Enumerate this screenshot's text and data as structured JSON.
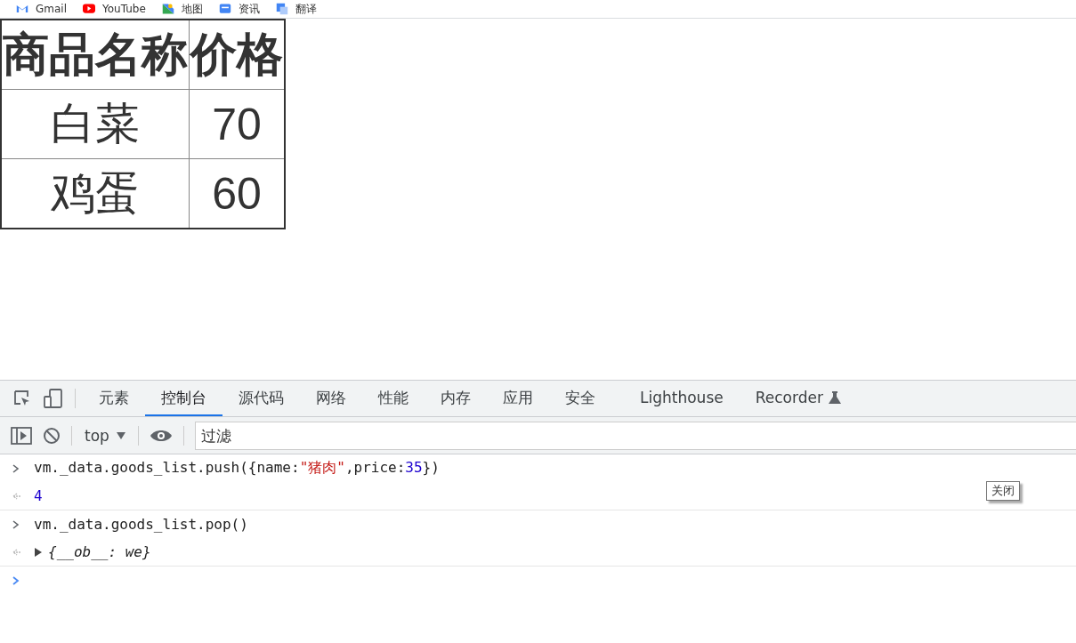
{
  "bookmarks": [
    {
      "label": "Gmail",
      "kind": "gmail"
    },
    {
      "label": "YouTube",
      "kind": "youtube"
    },
    {
      "label": "地图",
      "kind": "maps"
    },
    {
      "label": "资讯",
      "kind": "news"
    },
    {
      "label": "翻译",
      "kind": "translate"
    }
  ],
  "table": {
    "columns": [
      "商品名称",
      "价格"
    ],
    "rows": [
      [
        "白菜",
        "70"
      ],
      [
        "鸡蛋",
        "60"
      ]
    ]
  },
  "devtools": {
    "tabs": [
      {
        "label": "元素",
        "selected": false
      },
      {
        "label": "控制台",
        "selected": true
      },
      {
        "label": "源代码",
        "selected": false
      },
      {
        "label": "网络",
        "selected": false
      },
      {
        "label": "性能",
        "selected": false
      },
      {
        "label": "内存",
        "selected": false
      },
      {
        "label": "应用",
        "selected": false
      },
      {
        "label": "安全",
        "selected": false
      },
      {
        "label": "Lighthouse",
        "selected": false
      },
      {
        "label": "Recorder",
        "selected": false
      }
    ],
    "context": "top",
    "filter": {
      "placeholder": "过滤"
    },
    "console": [
      {
        "kind": "input",
        "tokens": [
          {
            "text": "vm._data.goods_list.push({name:",
            "kind": "plain"
          },
          {
            "text": "\"猪肉\"",
            "kind": "string"
          },
          {
            "text": ",price:",
            "kind": "plain"
          },
          {
            "text": "35",
            "kind": "number"
          },
          {
            "text": "})",
            "kind": "plain"
          }
        ]
      },
      {
        "kind": "output",
        "tokens": [
          {
            "text": "4",
            "kind": "number"
          }
        ]
      },
      {
        "kind": "input",
        "tokens": [
          {
            "text": "vm._data.goods_list.pop()",
            "kind": "plain"
          }
        ]
      },
      {
        "kind": "output",
        "expandable": true,
        "tokens": [
          {
            "text": "{__ob__: we}",
            "kind": "object"
          }
        ]
      }
    ],
    "tooltip": "关闭"
  }
}
